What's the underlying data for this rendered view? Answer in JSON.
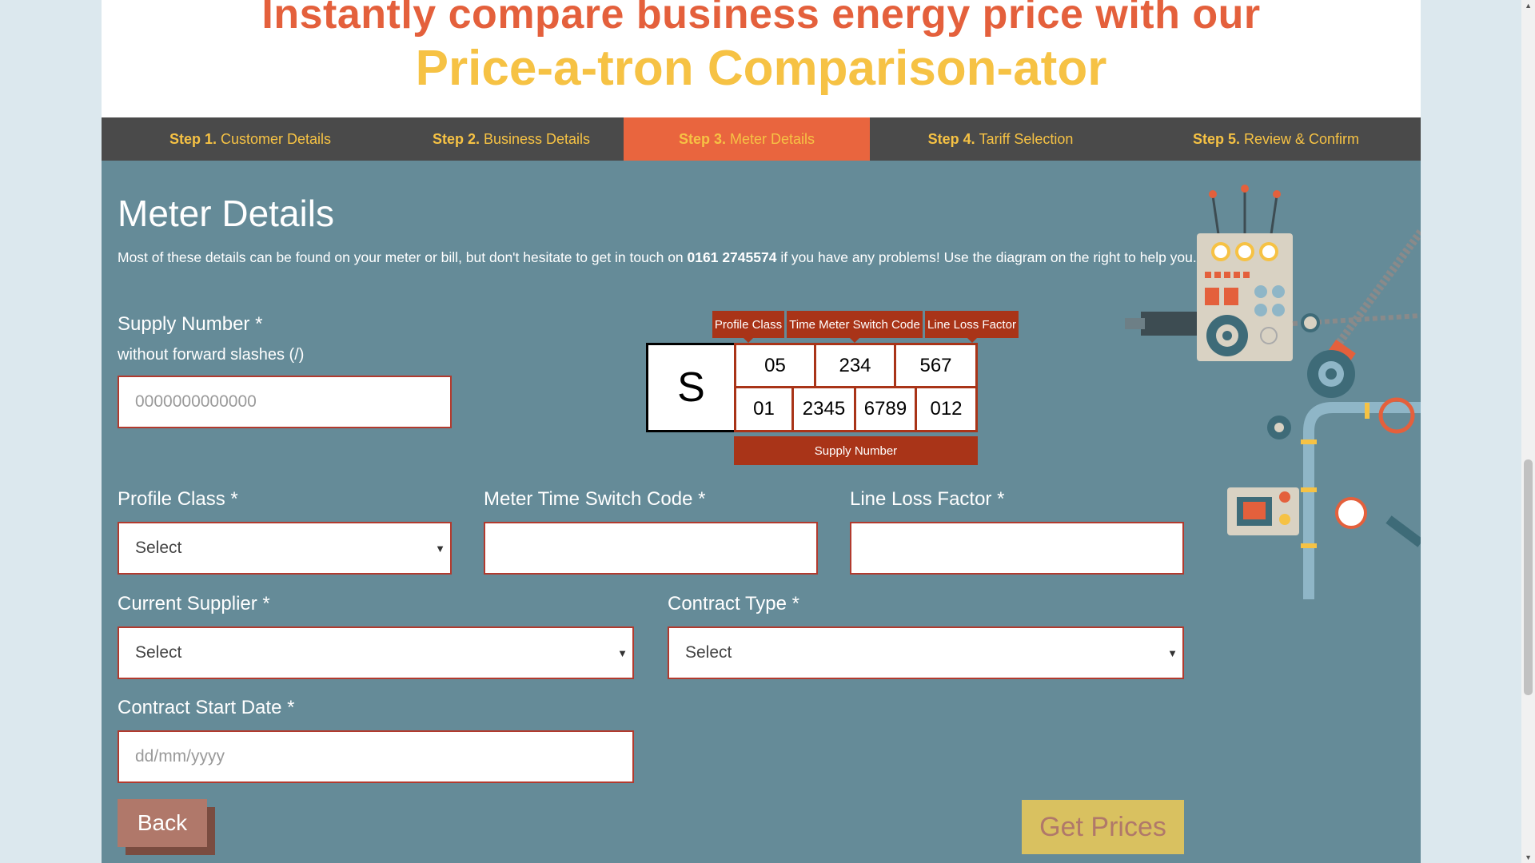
{
  "hero": {
    "line1": "Instantly compare business energy price with our",
    "line2": "Price-a-tron Comparison-ator"
  },
  "steps": [
    {
      "num": "Step 1.",
      "label": "Customer Details"
    },
    {
      "num": "Step 2.",
      "label": "Business Details"
    },
    {
      "num": "Step 3.",
      "label": "Meter Details"
    },
    {
      "num": "Step 4.",
      "label": "Tariff Selection"
    },
    {
      "num": "Step 5.",
      "label": "Review & Confirm"
    }
  ],
  "main": {
    "title": "Meter Details",
    "intro_before": "Most of these details can be found on your meter or bill, but don't hesitate to get in touch on ",
    "phone": "0161 2745574",
    "intro_after": " if you have any problems! Use the diagram on the right to help you."
  },
  "supply": {
    "label": "Supply Number *",
    "sublabel": "without forward slashes (/)",
    "placeholder": "0000000000000"
  },
  "diagram": {
    "tag_profile": "Profile Class",
    "tag_mtsc": "Time Meter Switch Code",
    "tag_llf": "Line Loss Factor",
    "s": "S",
    "top_cells": [
      "05",
      "234",
      "567"
    ],
    "bottom_cells": [
      "01",
      "2345",
      "6789",
      "012"
    ],
    "supply_label": "Supply Number"
  },
  "fields": {
    "profile_label": "Profile Class *",
    "profile_value": "Select",
    "mtsc_label": "Meter Time Switch Code *",
    "llf_label": "Line Loss Factor *",
    "supplier_label": "Current Supplier *",
    "supplier_value": "Select",
    "contract_label": "Contract Type *",
    "contract_value": "Select",
    "start_label": "Contract Start Date *",
    "start_placeholder": "dd/mm/yyyy"
  },
  "buttons": {
    "back": "Back",
    "get_prices": "Get Prices"
  },
  "colors": {
    "accent_orange": "#e9653e",
    "yellow": "#f6c244",
    "panel": "#658b98",
    "diagram_red": "#a93418"
  }
}
